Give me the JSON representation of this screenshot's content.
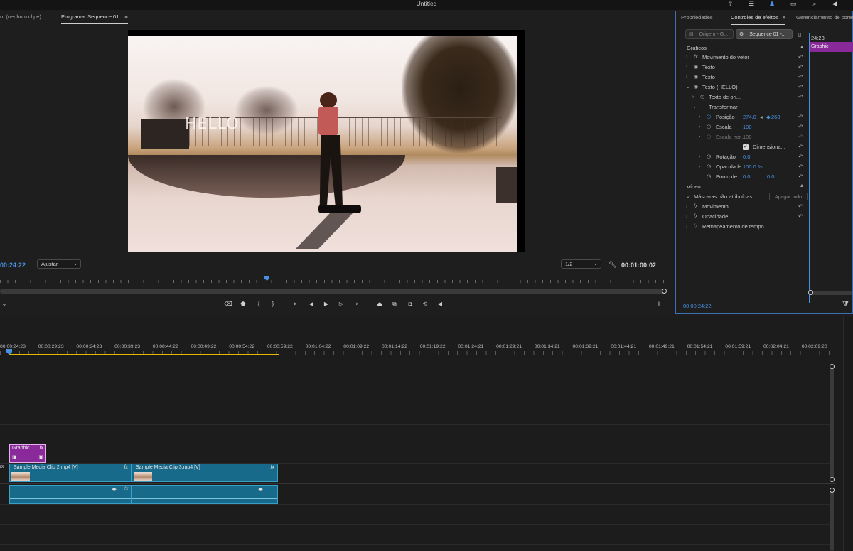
{
  "window": {
    "title": "Untitled"
  },
  "top_icons": [
    "share-icon",
    "workspaces-icon",
    "notification-icon",
    "comments-icon",
    "search-icon",
    "volume-icon"
  ],
  "monitor": {
    "source_tab": "n: (nenhum clipe)",
    "program_tab": "Programa: Sequence 01",
    "video_text": "HELLO",
    "timecode_left": "00:24:22",
    "fit_select": "Ajustar",
    "resolution_select": "1/2",
    "timecode_right": "00:01:00:02"
  },
  "effects_panel": {
    "tabs": [
      "Propriedades",
      "Controles de efeitos",
      "Gerenciamento de cores"
    ],
    "source_button": "Origem - G...",
    "sequence_button": "Sequence 01 -...",
    "mini_timecode": "24:23",
    "mini_clip": "Graphic",
    "section_graphics": "Gráficos",
    "rows": [
      "Movimento do vetor",
      "Texto",
      "Texto",
      "Texto (HELLO)",
      "Texto de ori...",
      "Transformar"
    ],
    "posicao": {
      "label": "Posição",
      "x": "274.0",
      "y": "268"
    },
    "escala": {
      "label": "Escala",
      "value": "100"
    },
    "escala_hor": {
      "label": "Escala hor...",
      "value": "100"
    },
    "dimensiona": {
      "label": "Dimensiona...",
      "checked": true
    },
    "rotacao": {
      "label": "Rotação",
      "value": "0.0"
    },
    "opacidade": {
      "label": "Opacidade",
      "value": "100.0 %"
    },
    "ponto": {
      "label": "Ponto de ...",
      "x": "0.0",
      "y": "0.0"
    },
    "section_video": "Vídeo",
    "mascaras": "Máscaras não atribuídas",
    "apagar": "Apagar tudo",
    "movimento": "Movimento",
    "opacidade_fx": "Opacidade",
    "remapeamento": "Remapeamento de tempo",
    "timecode": "00:00:24:22"
  },
  "timeline": {
    "ticks": [
      "00:00:24:23",
      "00:00:29:23",
      "00:00:34:23",
      "00:00:39:23",
      "00:00:44:22",
      "00:00:49:22",
      "00:00:54:22",
      "00:00:59:22",
      "00:01:04:22",
      "00:01:09:22",
      "00:01:14:22",
      "00:01:19:22",
      "00:01:24:21",
      "00:01:29:21",
      "00:01:34:21",
      "00:01:39:21",
      "00:01:44:21",
      "00:01:49:21",
      "00:01:54:21",
      "00:01:59:21",
      "00:02:04:21",
      "00:02:09:20"
    ],
    "graphic_clip": "Graphic",
    "clip1": "Sample Media Clip 2.mp4 [V]",
    "clip2": "Sample Media Clip 3.mp4 [V]",
    "fx_label": "fx"
  },
  "colors": {
    "accent": "#4a90e2",
    "clip_video": "#176a8a",
    "clip_graphic": "#8a2a9a",
    "work_area": "#e6b800"
  }
}
